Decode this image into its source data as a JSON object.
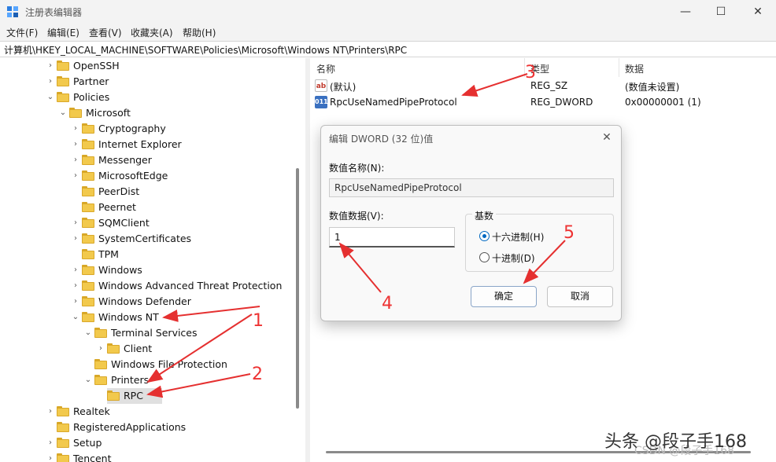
{
  "window": {
    "title": "注册表编辑器",
    "minimize_glyph": "—",
    "maximize_glyph": "☐",
    "close_glyph": "✕"
  },
  "menu": [
    "文件(F)",
    "编辑(E)",
    "查看(V)",
    "收藏夹(A)",
    "帮助(H)"
  ],
  "address": "计算机\\HKEY_LOCAL_MACHINE\\SOFTWARE\\Policies\\Microsoft\\Windows NT\\Printers\\RPC",
  "tree": [
    {
      "label": "OpenSSH",
      "twisty": "›"
    },
    {
      "label": "Partner",
      "twisty": "›"
    },
    {
      "label": "Policies",
      "twisty": "⌄"
    },
    {
      "label": "Microsoft",
      "twisty": "⌄"
    },
    {
      "label": "Cryptography",
      "twisty": "›"
    },
    {
      "label": "Internet Explorer",
      "twisty": "›"
    },
    {
      "label": "Messenger",
      "twisty": "›"
    },
    {
      "label": "MicrosoftEdge",
      "twisty": "›"
    },
    {
      "label": "PeerDist",
      "twisty": ""
    },
    {
      "label": "Peernet",
      "twisty": ""
    },
    {
      "label": "SQMClient",
      "twisty": "›"
    },
    {
      "label": "SystemCertificates",
      "twisty": "›"
    },
    {
      "label": "TPM",
      "twisty": ""
    },
    {
      "label": "Windows",
      "twisty": "›"
    },
    {
      "label": "Windows Advanced Threat Protection",
      "twisty": "›"
    },
    {
      "label": "Windows Defender",
      "twisty": "›"
    },
    {
      "label": "Windows NT",
      "twisty": "⌄"
    },
    {
      "label": "Terminal Services",
      "twisty": "⌄"
    },
    {
      "label": "Client",
      "twisty": "›"
    },
    {
      "label": "Windows File Protection",
      "twisty": ""
    },
    {
      "label": "Printers",
      "twisty": "⌄"
    },
    {
      "label": "RPC",
      "twisty": ""
    },
    {
      "label": "Realtek",
      "twisty": "›"
    },
    {
      "label": "RegisteredApplications",
      "twisty": ""
    },
    {
      "label": "Setup",
      "twisty": "›"
    },
    {
      "label": "Tencent",
      "twisty": "›"
    }
  ],
  "list": {
    "headers": {
      "name": "名称",
      "type": "类型",
      "data": "数据"
    },
    "rows": [
      {
        "icon": "ab",
        "name": "(默认)",
        "type": "REG_SZ",
        "data": "(数值未设置)"
      },
      {
        "icon": "011",
        "name": "RpcUseNamedPipeProtocol",
        "type": "REG_DWORD",
        "data": "0x00000001 (1)"
      }
    ]
  },
  "dialog": {
    "title": "编辑 DWORD (32 位)值",
    "close_glyph": "✕",
    "name_label": "数值名称(N):",
    "name_value": "RpcUseNamedPipeProtocol",
    "data_label": "数值数据(V):",
    "data_value": "1",
    "base_label": "基数",
    "base_options": [
      {
        "label": "十六进制(H)",
        "selected": true
      },
      {
        "label": "十进制(D)",
        "selected": false
      }
    ],
    "ok": "确定",
    "cancel": "取消"
  },
  "annotations": [
    "1",
    "2",
    "3",
    "4",
    "5"
  ],
  "watermark": "头条 @段子手168",
  "watermark_faint": "CSDN @段子手168"
}
